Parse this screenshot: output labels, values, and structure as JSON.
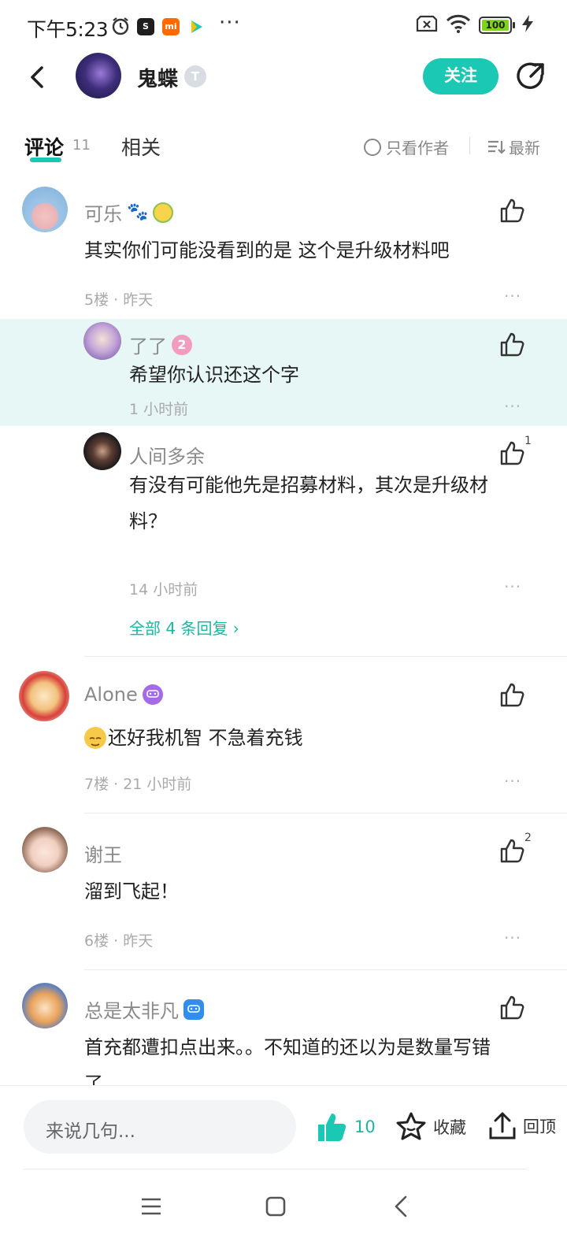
{
  "status": {
    "time": "下午5:23",
    "battery": "100",
    "more": "···"
  },
  "header": {
    "author_name": "鬼蝶",
    "level_badge": "T",
    "follow_label": "关注"
  },
  "tabs": {
    "comment_label": "评论",
    "comment_count": "11",
    "related_label": "相关",
    "only_author_label": "只看作者",
    "sort_label": "最新"
  },
  "comments": [
    {
      "name": "可乐",
      "text": "其实你们可能没看到的是  这个是升级材料吧",
      "meta": "5楼 · 昨天",
      "likes": ""
    },
    {
      "name": "了了",
      "badge": "2",
      "text": "希望你认识还这个字",
      "meta": "1 小时前"
    },
    {
      "name": "人间多余",
      "text_line1": "有没有可能他先是招募材料，其次是升级材",
      "text_line2": "料？",
      "meta": "14 小时前",
      "likes": "1"
    },
    {
      "name": "Alone",
      "text": "还好我机智 不急着充钱",
      "meta": "7楼 · 21 小时前"
    },
    {
      "name": "谢王",
      "text": "溜到飞起！",
      "meta": "6楼 · 昨天",
      "likes": "2"
    },
    {
      "name": "总是太非凡",
      "text_line1": "首充都遭扣点出来。。不知道的还以为是数量写错",
      "text_line2": "了"
    }
  ],
  "all_replies": "全部 4 条回复 ›",
  "more_dots": "···",
  "bottom": {
    "input_placeholder": "来说几句...",
    "like_count": "10",
    "fav_label": "收藏",
    "top_label": "回顶"
  },
  "colors": {
    "accent": "#1ac8b3",
    "highlight_bg": "#e6f7f5"
  }
}
